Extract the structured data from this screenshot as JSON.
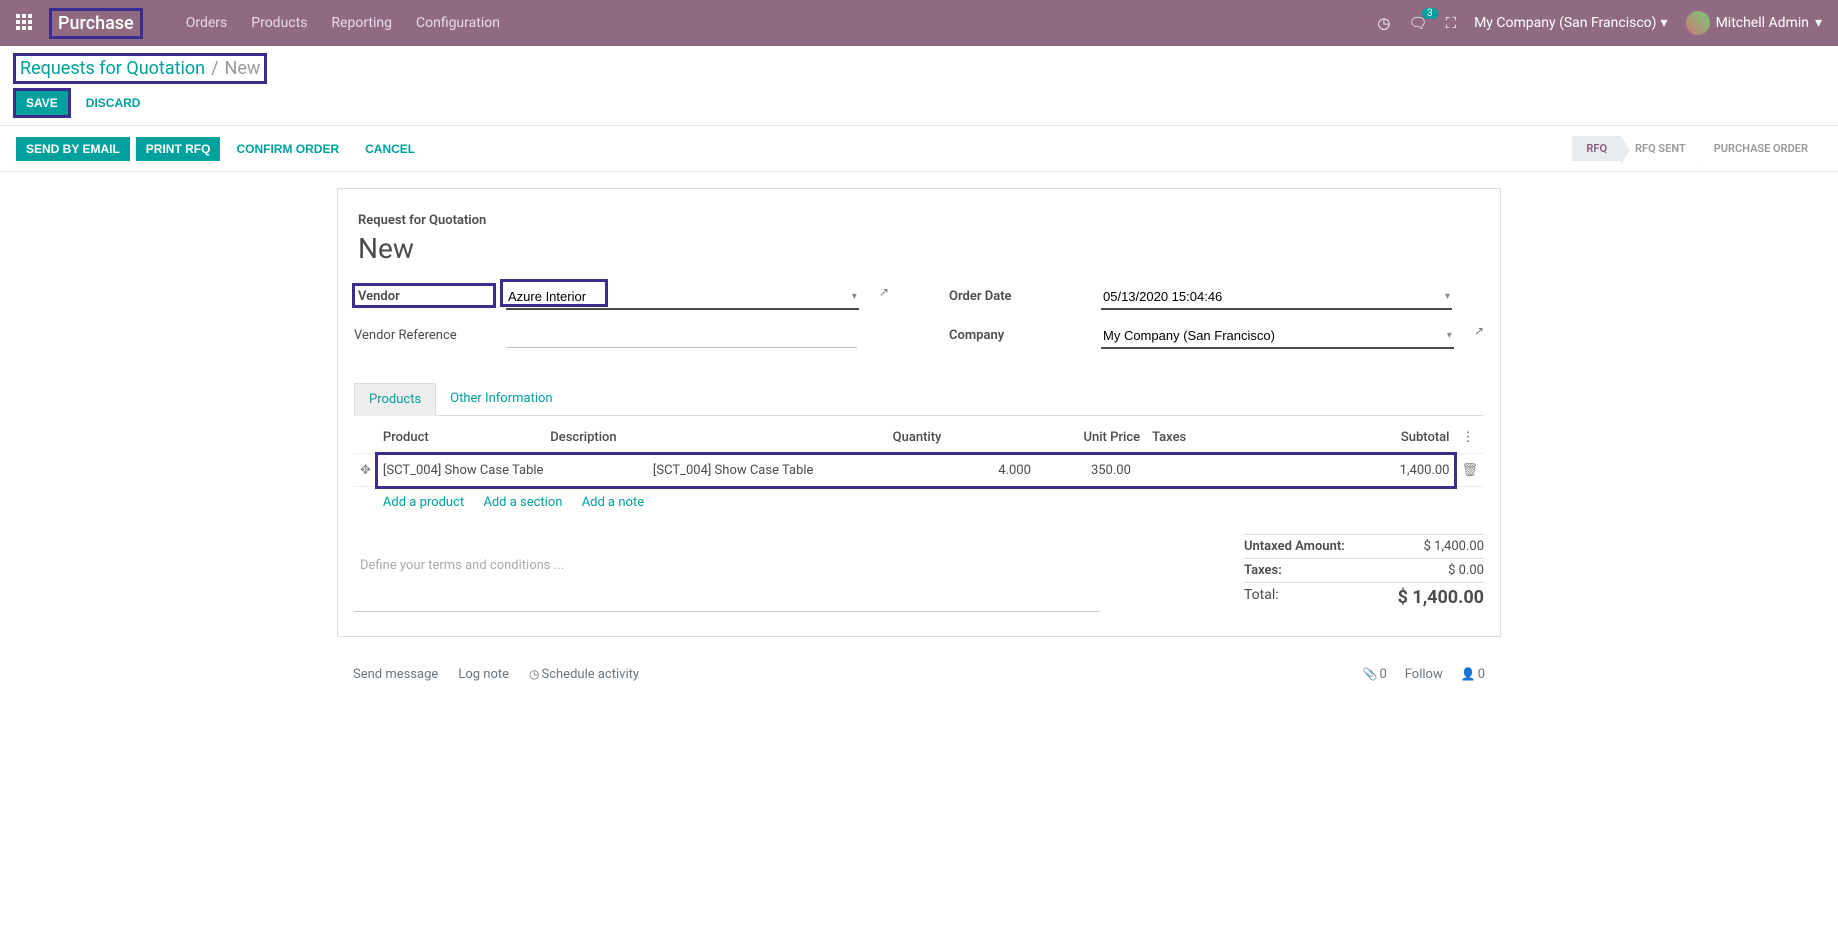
{
  "navbar": {
    "brand": "Purchase",
    "menu": [
      "Orders",
      "Products",
      "Reporting",
      "Configuration"
    ],
    "messages_count": "3",
    "company": "My Company (San Francisco)",
    "user": "Mitchell Admin"
  },
  "breadcrumb": {
    "parent": "Requests for Quotation",
    "current": "New"
  },
  "cp": {
    "save": "SAVE",
    "discard": "DISCARD"
  },
  "statusbar": {
    "buttons": [
      "SEND BY EMAIL",
      "PRINT RFQ",
      "CONFIRM ORDER",
      "CANCEL"
    ],
    "steps": [
      "RFQ",
      "RFQ SENT",
      "PURCHASE ORDER"
    ]
  },
  "form": {
    "subtitle": "Request for Quotation",
    "title": "New",
    "fields": {
      "vendor_label": "Vendor",
      "vendor_value": "Azure Interior",
      "vendor_ref_label": "Vendor Reference",
      "vendor_ref_value": "",
      "order_date_label": "Order Date",
      "order_date_value": "05/13/2020 15:04:46",
      "company_label": "Company",
      "company_value": "My Company (San Francisco)"
    }
  },
  "tabs": {
    "products": "Products",
    "other": "Other Information"
  },
  "table": {
    "headers": {
      "product": "Product",
      "description": "Description",
      "quantity": "Quantity",
      "unit_price": "Unit Price",
      "taxes": "Taxes",
      "subtotal": "Subtotal"
    },
    "row": {
      "product": "[SCT_004] Show Case Table",
      "description": "[SCT_004] Show Case Table",
      "quantity": "4.000",
      "unit_price": "350.00",
      "subtotal": "1,400.00"
    },
    "add_product": "Add a product",
    "add_section": "Add a section",
    "add_note": "Add a note",
    "terms_placeholder": "Define your terms and conditions ..."
  },
  "totals": {
    "untaxed_label": "Untaxed Amount:",
    "untaxed_value": "$ 1,400.00",
    "taxes_label": "Taxes:",
    "taxes_value": "$ 0.00",
    "total_label": "Total:",
    "total_value": "$ 1,400.00"
  },
  "chatter": {
    "send_message": "Send message",
    "log_note": "Log note",
    "schedule": "Schedule activity",
    "attach_count": "0",
    "follow": "Follow",
    "followers": "0"
  }
}
